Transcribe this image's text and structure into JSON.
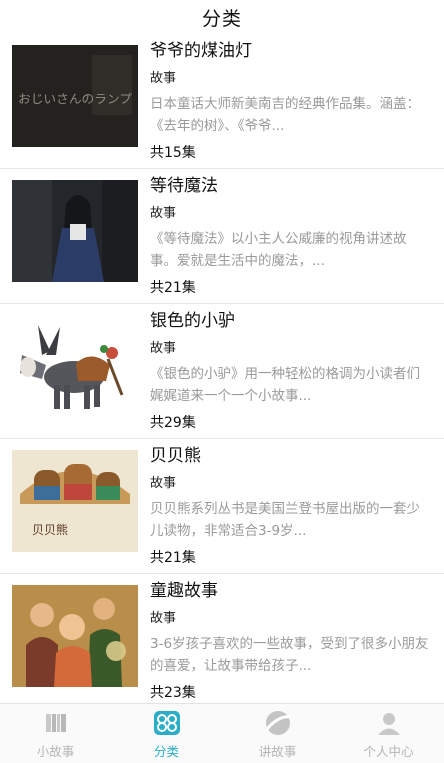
{
  "header": {
    "title": "分类"
  },
  "items": [
    {
      "title": "爷爷的煤油灯",
      "category": "故事",
      "desc": "日本童话大师新美南吉的经典作品集。涵盖：《去年的树》、《爷爷...",
      "count": "共15集",
      "thumb_text": "おじいさんのランプ"
    },
    {
      "title": "等待魔法",
      "category": "故事",
      "desc": "《等待魔法》以小主人公威廉的视角讲述故事。爱就是生活中的魔法，...",
      "count": "共21集"
    },
    {
      "title": "银色的小驴",
      "category": "故事",
      "desc": "《银色的小驴》用一种轻松的格调为小读者们娓娓道来一个一个小故事...",
      "count": "共29集"
    },
    {
      "title": "贝贝熊",
      "category": "故事",
      "desc": "贝贝熊系列丛书是美国兰登书屋出版的一套少儿读物，非常适合3-9岁...",
      "count": "共21集",
      "thumb_text": "贝贝熊"
    },
    {
      "title": "童趣故事",
      "category": "故事",
      "desc": "3-6岁孩子喜欢的一些故事，受到了很多小朋友的喜爱，让故事带给孩子...",
      "count": "共23集"
    }
  ],
  "tabbar": {
    "tabs": [
      {
        "label": "小故事",
        "icon": "book-stack-icon"
      },
      {
        "label": "分类",
        "icon": "category-clover-icon"
      },
      {
        "label": "讲故事",
        "icon": "microphone-icon"
      },
      {
        "label": "个人中心",
        "icon": "user-icon"
      }
    ],
    "active_index": 1,
    "active_color": "#2aaec8",
    "inactive_color": "#b5b5b5"
  }
}
